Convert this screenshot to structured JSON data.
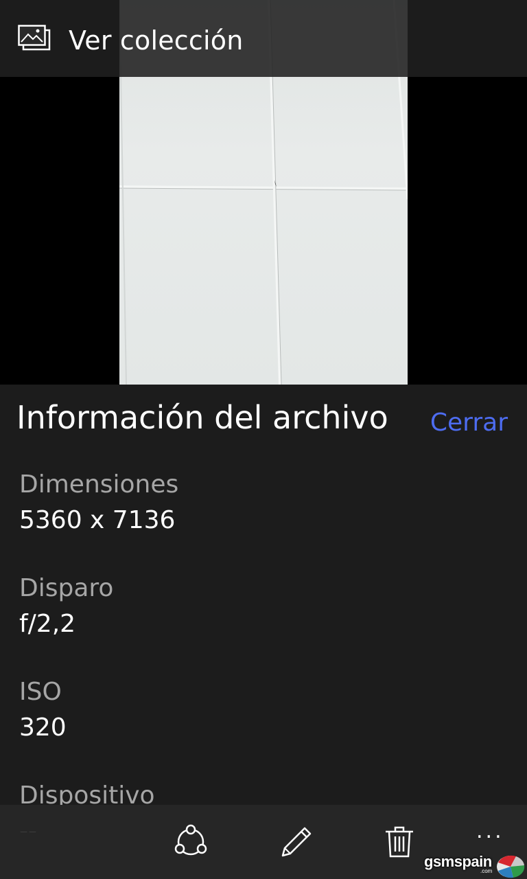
{
  "header": {
    "title": "Ver colección",
    "icon": "photo-collection-icon"
  },
  "info_panel": {
    "title": "Información del archivo",
    "close_label": "Cerrar",
    "fields": [
      {
        "label": "Dimensiones",
        "value": "5360 x 7136"
      },
      {
        "label": "Disparo",
        "value": "f/2,2"
      },
      {
        "label": "ISO",
        "value": "320"
      },
      {
        "label": "Dispositivo",
        "value": "--"
      }
    ]
  },
  "appbar": {
    "buttons": [
      {
        "name": "share",
        "icon": "share-icon"
      },
      {
        "name": "edit",
        "icon": "pencil-icon"
      },
      {
        "name": "delete",
        "icon": "trash-icon"
      }
    ],
    "more_label": "..."
  },
  "watermark": {
    "text": "gsmspain",
    "sub": ".com"
  },
  "colors": {
    "accent": "#4d6cf0",
    "panel_bg": "#1c1c1c",
    "appbar_bg": "#262626",
    "label_gray": "#a6a6a6"
  }
}
